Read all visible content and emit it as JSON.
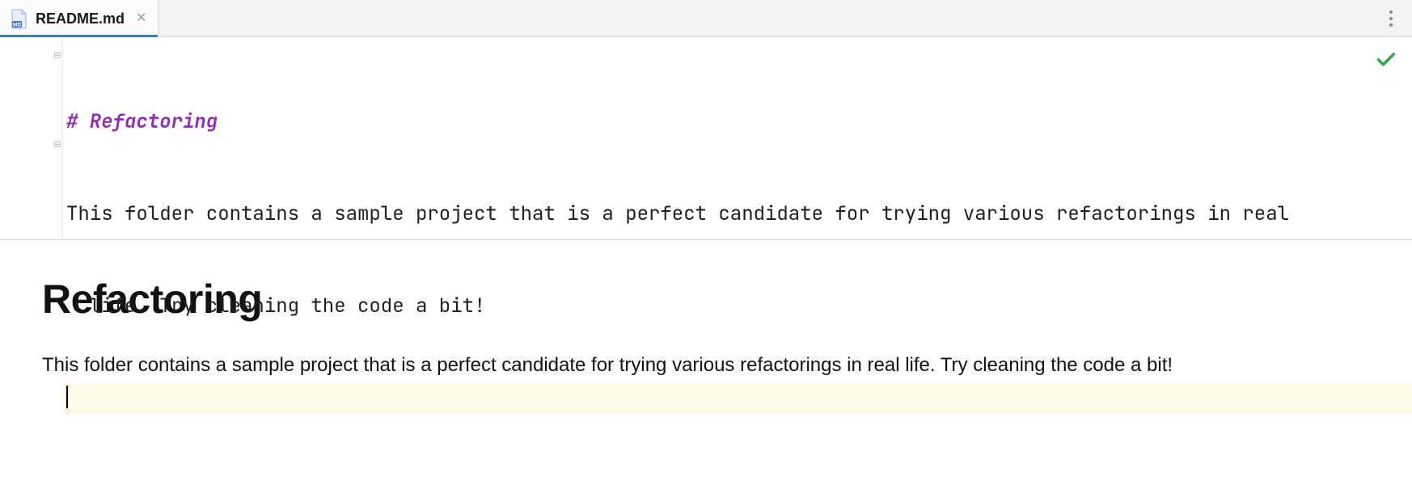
{
  "tabs": {
    "active": {
      "filename": "README.md",
      "icon": "markdown-file-icon"
    }
  },
  "editor": {
    "lines": {
      "l1": "# Refactoring",
      "l2": "This folder contains a sample project that is a perfect candidate for trying various refactorings in real",
      "l3": "  life. Try cleaning the code a bit!",
      "l4": ""
    },
    "status": "ok"
  },
  "preview": {
    "heading": "Refactoring",
    "body": "This folder contains a sample project that is a perfect candidate for trying various refactorings in real life. Try cleaning the code a bit!"
  }
}
